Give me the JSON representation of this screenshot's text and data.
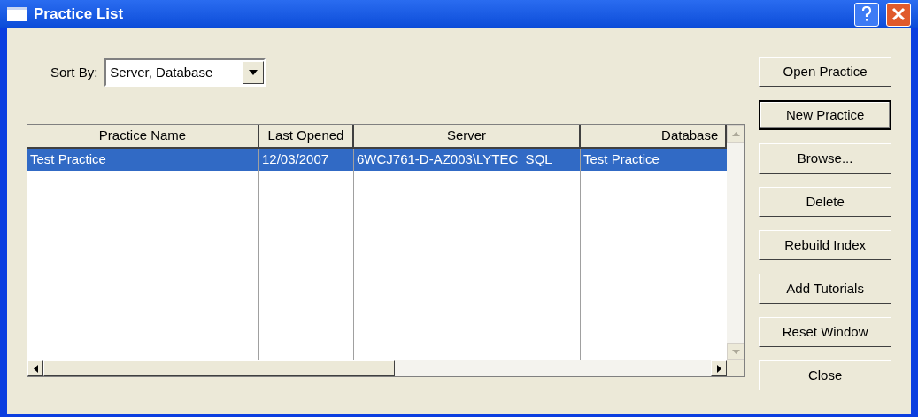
{
  "window": {
    "title": "Practice List"
  },
  "sort_by": {
    "label": "Sort By:",
    "value": "Server, Database"
  },
  "table": {
    "columns": [
      {
        "label": "Practice Name"
      },
      {
        "label": "Last Opened"
      },
      {
        "label": "Server"
      },
      {
        "label": "Database"
      }
    ],
    "rows": [
      {
        "selected": true,
        "cells": [
          "Test Practice",
          "12/03/2007",
          "6WCJ761-D-AZ003\\LYTEC_SQL",
          "Test Practice"
        ]
      }
    ]
  },
  "buttons": [
    {
      "label": "Open Practice",
      "default": false
    },
    {
      "label": "New Practice",
      "default": true
    },
    {
      "label": "Browse...",
      "default": false
    },
    {
      "label": "Delete",
      "default": false
    },
    {
      "label": "Rebuild Index",
      "default": false
    },
    {
      "label": "Add Tutorials",
      "default": false
    },
    {
      "label": "Reset Window",
      "default": false
    },
    {
      "label": "Close",
      "default": false
    }
  ]
}
